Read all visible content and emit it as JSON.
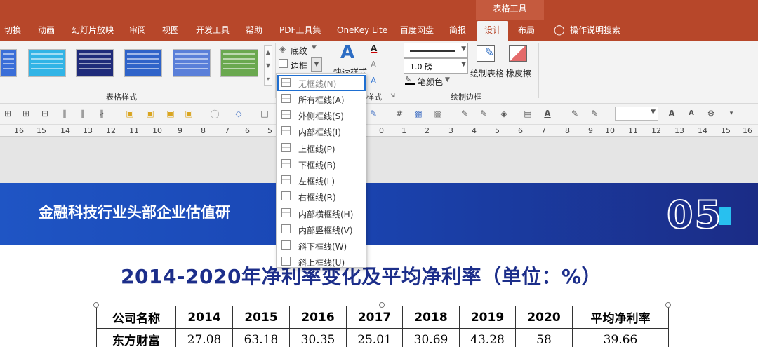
{
  "ribbon": {
    "context_group": "表格工具",
    "tabs": [
      "切换",
      "动画",
      "幻灯片放映",
      "审阅",
      "视图",
      "开发工具",
      "帮助",
      "PDF工具集",
      "OneKey Lite",
      "百度网盘",
      "简报",
      "设计",
      "布局"
    ],
    "active_tab": "设计",
    "tell_me": "操作说明搜索",
    "shading_label": "底纹",
    "borders_label": "边框",
    "quick_styles_label": "快速样式",
    "pen_weight": "1.0 磅",
    "pen_color_label": "笔颜色",
    "draw_table_label": "绘制表格",
    "eraser_label": "橡皮擦",
    "group_table_styles": "表格样式",
    "group_wordart_partial": "样式",
    "group_draw_borders": "绘制边框",
    "swatch_colors": [
      "#3a6ed8",
      "#31b4e6",
      "#1f2b7a",
      "#2f63c9",
      "#5a7fd9",
      "#6aa84f"
    ]
  },
  "ruler": {
    "left_ticks": [
      "16",
      "15",
      "14",
      "13",
      "12",
      "11",
      "10",
      "9",
      "8",
      "7",
      "6",
      "5"
    ],
    "right_ticks": [
      "0",
      "1",
      "2",
      "3",
      "4",
      "5",
      "6",
      "7",
      "8",
      "9",
      "10",
      "11",
      "12",
      "13",
      "14",
      "15",
      "16"
    ]
  },
  "border_menu": {
    "items": [
      {
        "label": "无框线(N)",
        "selected": true
      },
      {
        "label": "所有框线(A)"
      },
      {
        "label": "外侧框线(S)"
      },
      {
        "label": "内部框线(I)"
      },
      {
        "label": "上框线(P)"
      },
      {
        "label": "下框线(B)"
      },
      {
        "label": "左框线(L)"
      },
      {
        "label": "右框线(R)"
      },
      {
        "label": "内部横框线(H)"
      },
      {
        "label": "内部竖框线(V)"
      },
      {
        "label": "斜下框线(W)"
      },
      {
        "label": "斜上框线(U)"
      }
    ]
  },
  "slide": {
    "banner_title": "金融科技行业头部企业估值研",
    "number": "05",
    "title": "2014-2020年净利率变化及平均净利率（单位：%）",
    "table": {
      "headers": [
        "公司名称",
        "2014",
        "2015",
        "2016",
        "2017",
        "2018",
        "2019",
        "2020",
        "平均净利率"
      ],
      "rows": [
        [
          "东方财富",
          "27.08",
          "63.18",
          "30.35",
          "25.01",
          "30.69",
          "43.28",
          "58",
          "39.66"
        ]
      ]
    }
  },
  "colors": {
    "ribbon_tab_bg": "#b7472a",
    "banner_start": "#1f55c4",
    "banner_end": "#1b2c86",
    "title_text": "#1c2e8a",
    "accent": "#28c0ef",
    "selection": "#1f6fd1"
  }
}
